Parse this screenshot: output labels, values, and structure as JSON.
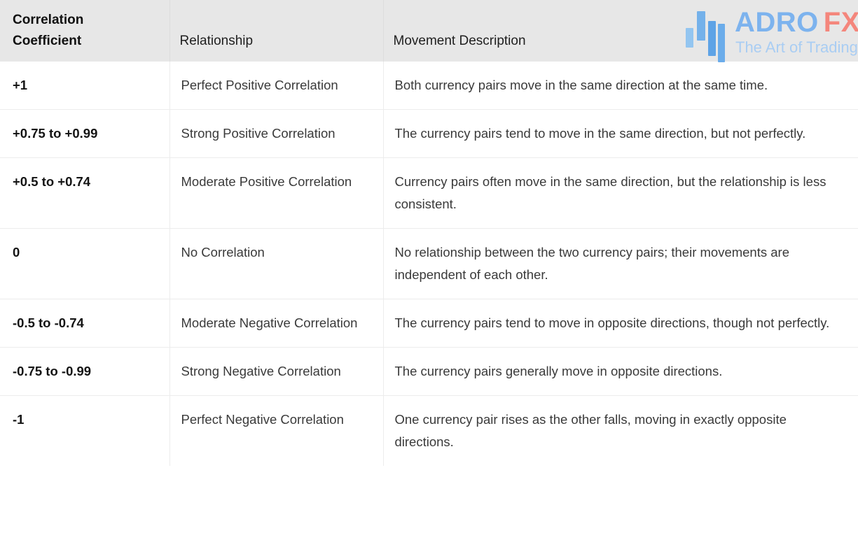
{
  "logo": {
    "brand_primary": "ADRO",
    "brand_secondary": "FX",
    "tagline": "The Art of Trading",
    "colors": {
      "primary": "#7db3ee",
      "secondary": "#f4867c",
      "tagline": "#a9cdf3",
      "candle_light": "#93c5f0",
      "candle_dark": "#5ea3e6"
    }
  },
  "table": {
    "header": {
      "col1_line1": "Correlation",
      "col1_line2": "Coefficient",
      "col2": "Relationship",
      "col3": "Movement Description",
      "background": "#e7e7e7"
    },
    "rows": [
      {
        "coefficient": "+1",
        "relationship": "Perfect Positive Correlation",
        "description": "Both currency pairs move in the same direction at the same time."
      },
      {
        "coefficient": "+0.75 to +0.99",
        "relationship": "Strong Positive Correlation",
        "description": "The currency pairs tend to move in the same direction, but not perfectly."
      },
      {
        "coefficient": "+0.5 to +0.74",
        "relationship": "Moderate Positive Correlation",
        "description": "Currency pairs often move in the same direction, but the relationship is less consistent."
      },
      {
        "coefficient": "0",
        "relationship": "No Correlation",
        "description": "No relationship between the two currency pairs; their movements are independent of each other."
      },
      {
        "coefficient": "-0.5 to -0.74",
        "relationship": "Moderate Negative Correlation",
        "description": "The currency pairs tend to move in opposite directions, though not perfectly."
      },
      {
        "coefficient": "-0.75 to -0.99",
        "relationship": "Strong Negative Correlation",
        "description": "The currency pairs generally move in opposite directions."
      },
      {
        "coefficient": "-1",
        "relationship": "Perfect Negative Correlation",
        "description": "One currency pair rises as the other falls, moving in exactly opposite directions."
      }
    ]
  }
}
